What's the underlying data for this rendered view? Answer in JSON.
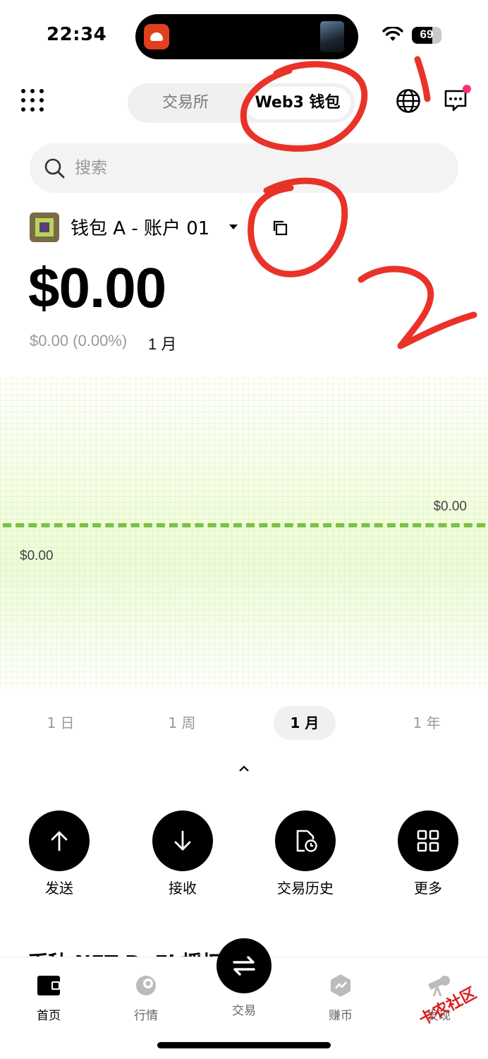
{
  "status_bar": {
    "time": "22:34",
    "battery": "69",
    "battery_level": 0.69
  },
  "header": {
    "tabs": [
      {
        "label": "交易所",
        "active": false
      },
      {
        "label": "Web3 钱包",
        "active": true
      }
    ]
  },
  "search": {
    "placeholder": "搜索"
  },
  "account": {
    "name": "钱包 A - 账户 01"
  },
  "balance": {
    "amount": "$0.00",
    "change": "$0.00 (0.00%)",
    "period": "1 月"
  },
  "chart_data": {
    "type": "line",
    "series": [
      {
        "values": [
          0,
          0
        ]
      }
    ],
    "right_label": "$0.00",
    "left_label": "$0.00",
    "grid": true
  },
  "periods": [
    "1 日",
    "1 周",
    "1 月",
    "1 年"
  ],
  "active_period_index": 2,
  "actions": [
    {
      "label": "发送",
      "icon": "arrow-up-icon"
    },
    {
      "label": "接收",
      "icon": "arrow-down-icon"
    },
    {
      "label": "交易历史",
      "icon": "history-icon"
    },
    {
      "label": "更多",
      "icon": "more-grid-icon"
    }
  ],
  "peek_tabs_text": "币种 NFT DeFi 授权",
  "bottom_nav": {
    "tabs": [
      {
        "label": "首页",
        "icon": "wallet-icon",
        "active": true
      },
      {
        "label": "行情",
        "icon": "market-icon",
        "active": false
      },
      {
        "label": "交易",
        "icon": "swap-icon",
        "active": false
      },
      {
        "label": "赚币",
        "icon": "earn-icon",
        "active": false
      },
      {
        "label": "发现",
        "icon": "telescope-icon",
        "active": false
      }
    ]
  },
  "watermark": "卡农社区",
  "colors": {
    "accent_green": "#7cc244",
    "annotation_red": "#e8281e",
    "notification_dot": "#ff2d7a"
  }
}
